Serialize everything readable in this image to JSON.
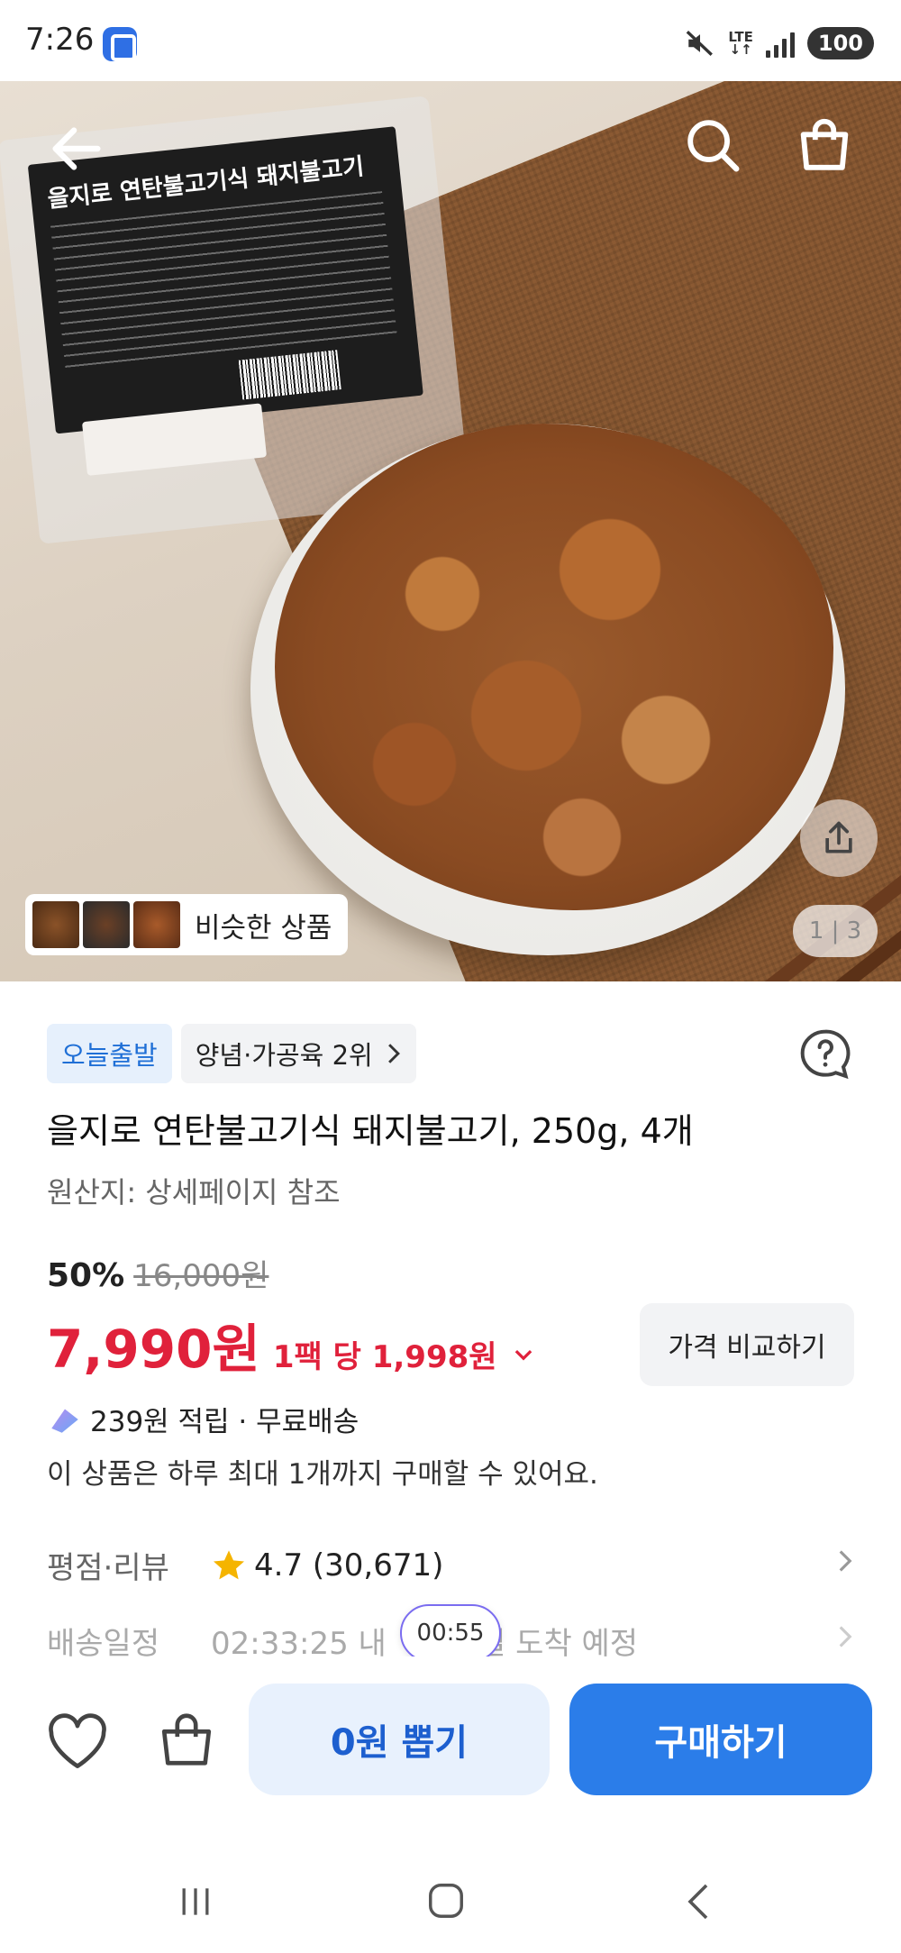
{
  "status_bar": {
    "time": "7:26",
    "network": "LTE",
    "battery": "100"
  },
  "hero": {
    "package_label": "을지로 연탄불고기식 돼지불고기",
    "similar_products_label": "비슷한 상품",
    "page_counter": "1 | 3"
  },
  "product": {
    "badge_today": "오늘출발",
    "badge_rank": "양념·가공육 2위",
    "title": "을지로 연탄불고기식 돼지불고기, 250g, 4개",
    "origin": "원산지: 상세페이지 참조",
    "discount": "50%",
    "original_price": "16,000원",
    "price": "7,990원",
    "unit_price": "1팩 당 1,998원",
    "compare_button": "가격 비교하기",
    "points": "239원 적립 · 무료배송",
    "limit_note": "이 상품은 하루 최대 1개까지 구매할 수 있어요.",
    "review_label": "평점·리뷰",
    "rating": "4.7 (30,671)",
    "delivery_label": "배송일정",
    "delivery_value": "02:33:25 내",
    "delivery_arrival": "내일 도착 예정",
    "timer": "00:55"
  },
  "bottom_bar": {
    "draw_button": "0원 뽑기",
    "buy_button": "구매하기"
  },
  "colors": {
    "price_red": "#e0213b",
    "brand_blue": "#2b7de9",
    "badge_blue_text": "#1f6fd6",
    "star": "#f5b400"
  }
}
